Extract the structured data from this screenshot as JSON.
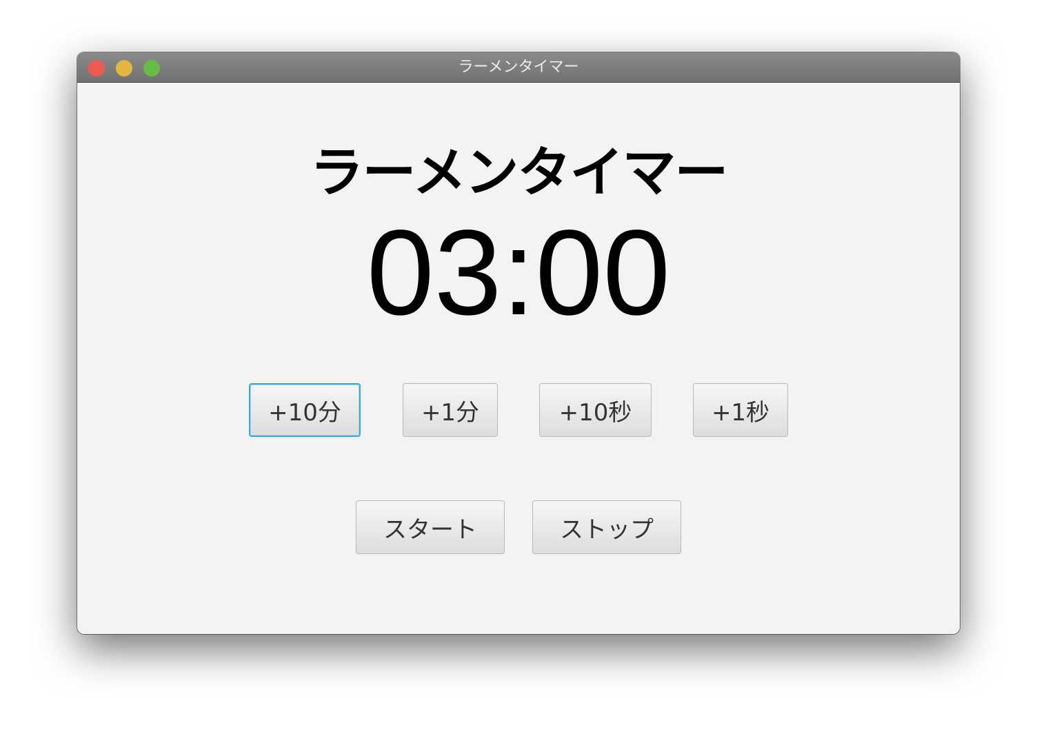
{
  "window": {
    "title": "ラーメンタイマー"
  },
  "app": {
    "heading": "ラーメンタイマー",
    "timer_display": "03:00"
  },
  "buttons": {
    "add_10_min": "+10分",
    "add_1_min": "+1分",
    "add_10_sec": "+10秒",
    "add_1_sec": "+1秒",
    "start": "スタート",
    "stop": "ストップ"
  },
  "colors": {
    "close": "#ee5a52",
    "minimize": "#e3b63f",
    "maximize": "#67bd45",
    "focus_ring": "#3aa9dd"
  }
}
